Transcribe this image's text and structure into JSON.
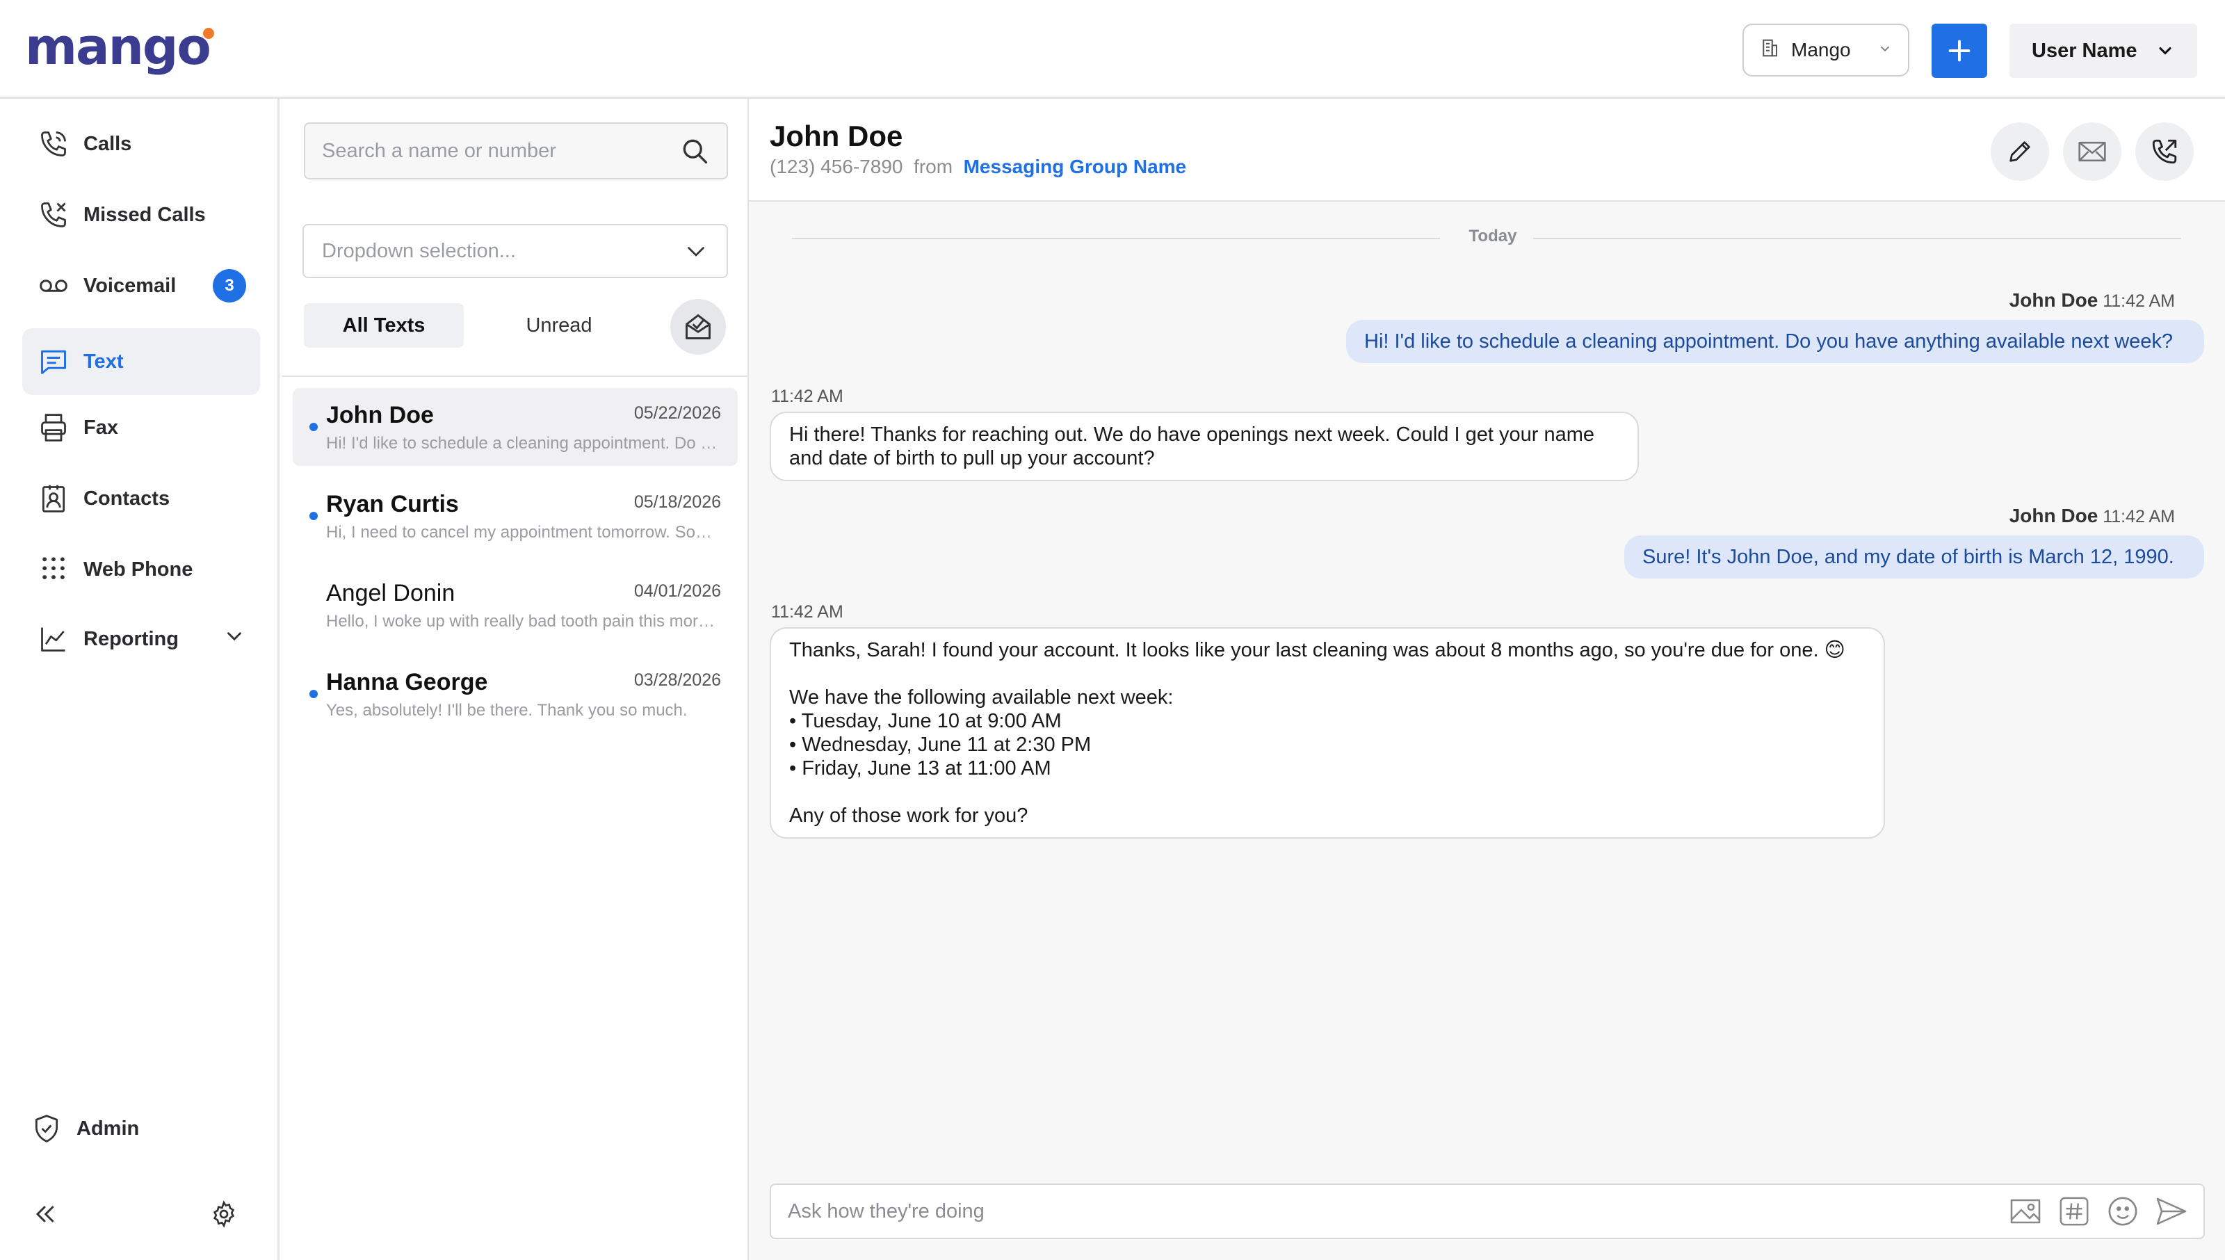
{
  "app": {
    "logo_text": "mango",
    "org_select": "Mango",
    "user_menu": "User Name",
    "accent_color": "#1f6fe5",
    "logo_dot_color": "#f07a2c"
  },
  "nav": {
    "items": [
      {
        "label": "Calls",
        "icon": "phone-icon"
      },
      {
        "label": "Missed Calls",
        "icon": "missed-call-icon"
      },
      {
        "label": "Voicemail",
        "icon": "voicemail-icon",
        "badge": "3"
      },
      {
        "label": "Text",
        "icon": "chat-icon",
        "active": true
      },
      {
        "label": "Fax",
        "icon": "printer-icon"
      },
      {
        "label": "Contacts",
        "icon": "contact-card-icon"
      },
      {
        "label": "Web Phone",
        "icon": "dialpad-icon"
      },
      {
        "label": "Reporting",
        "icon": "chart-line-icon"
      }
    ],
    "admin": "Admin"
  },
  "list": {
    "search_placeholder": "Search a name or number",
    "dropdown_placeholder": "Dropdown selection...",
    "tabs": [
      "All Texts",
      "Unread"
    ],
    "conversations": [
      {
        "name": "John Doe",
        "date": "05/22/2026",
        "preview": "Hi! I'd like to schedule a cleaning appointment. Do you have anything available next week?",
        "unread": true
      },
      {
        "name": "Ryan Curtis",
        "date": "05/18/2026",
        "preview": "Hi, I need to cancel my appointment tomorrow. Something came up at work.",
        "unread": true
      },
      {
        "name": "Angel Donin",
        "date": "04/01/2026",
        "preview": "Hello, I woke up with really bad tooth pain this morning. Can I come in today?",
        "unread": false
      },
      {
        "name": "Hanna George",
        "date": "03/28/2026",
        "preview": "Yes, absolutely! I'll be there. Thank you so much.",
        "unread": true
      }
    ]
  },
  "chat": {
    "contact_name": "John Doe",
    "contact_phone": "(123) 456-7890",
    "from_label": "from",
    "group_name": "Messaging Group Name",
    "day_divider": "Today",
    "messages": [
      {
        "direction": "out",
        "sender": "John Doe",
        "time": "11:42 AM",
        "text": "Hi! I'd like to schedule a cleaning appointment. Do you have anything available next week?"
      },
      {
        "direction": "in",
        "time": "11:42 AM",
        "text": "Hi there! Thanks for reaching out. We do have openings next week. Could I get your name and date of birth to pull up your account?"
      },
      {
        "direction": "out",
        "sender": "John Doe",
        "time": "11:42 AM",
        "text": "Sure! It's John Doe, and my date of birth is March 12, 1990."
      },
      {
        "direction": "in",
        "time": "11:42 AM",
        "text": "Thanks, Sarah! I found your account. It looks like your last cleaning was about 8 months ago, so you're due for one. 😊\n\nWe have the following available next week:\n• Tuesday, June 10 at 9:00 AM\n• Wednesday, June 11 at 2:30 PM\n• Friday, June 13 at 11:00 AM\n\nAny of those work for you?"
      }
    ],
    "composer_placeholder": "Ask how they're doing"
  }
}
